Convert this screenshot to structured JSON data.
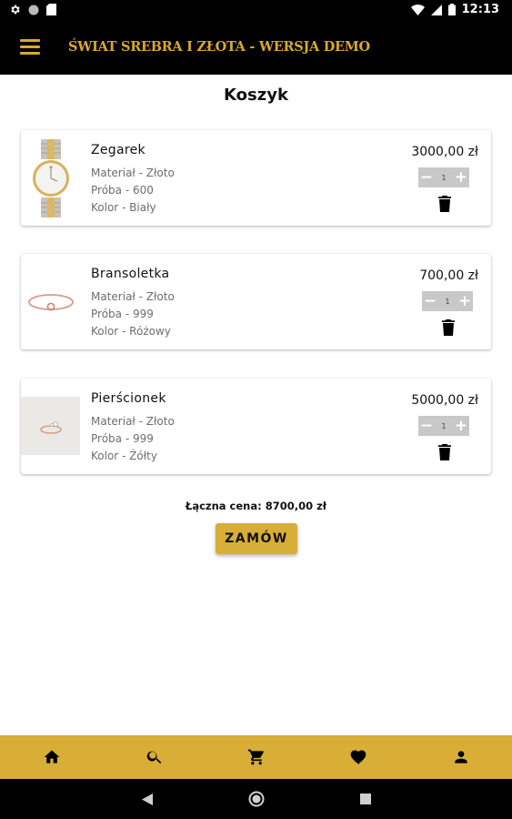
{
  "status_bar": {
    "time": "12:13",
    "icons": [
      "gear-icon",
      "circle-icon",
      "sd-card-icon",
      "wifi-icon",
      "signal-icon",
      "battery-icon"
    ]
  },
  "app_bar": {
    "title": "ŚWIAT SREBRA I ZŁOTA - WERSJA DEMO",
    "menu_icon": "hamburger-icon"
  },
  "page": {
    "title": "Koszyk"
  },
  "cart": {
    "items": [
      {
        "name": "Zegarek",
        "attr1": "Materiał - Złoto",
        "attr2": "Próba - 600",
        "attr3": "Kolor - Biały",
        "price": "3000,00 zł",
        "qty": "1"
      },
      {
        "name": "Bransoletka",
        "attr1": "Materiał - Złoto",
        "attr2": "Próba - 999",
        "attr3": "Kolor - Różowy",
        "price": "700,00 zł",
        "qty": "1"
      },
      {
        "name": "Pierścionek",
        "attr1": "Materiał - Złoto",
        "attr2": "Próba - 999",
        "attr3": "Kolor - Żółty",
        "price": "5000,00 zł",
        "qty": "1"
      }
    ],
    "stepper": {
      "minus": "−",
      "plus": "+"
    },
    "total_text": "Łączna cena: 8700,00 zł",
    "order_label": "ZAMÓW"
  },
  "bottom_nav": {
    "items": [
      "home-icon",
      "search-icon",
      "cart-icon",
      "heart-icon",
      "person-icon"
    ]
  },
  "system_nav": {
    "items": [
      "back-icon",
      "home-circle-icon",
      "recents-icon"
    ]
  },
  "colors": {
    "accent": "#d8ae37",
    "title_gold": "#d8a92a",
    "bar_black": "#000000"
  }
}
